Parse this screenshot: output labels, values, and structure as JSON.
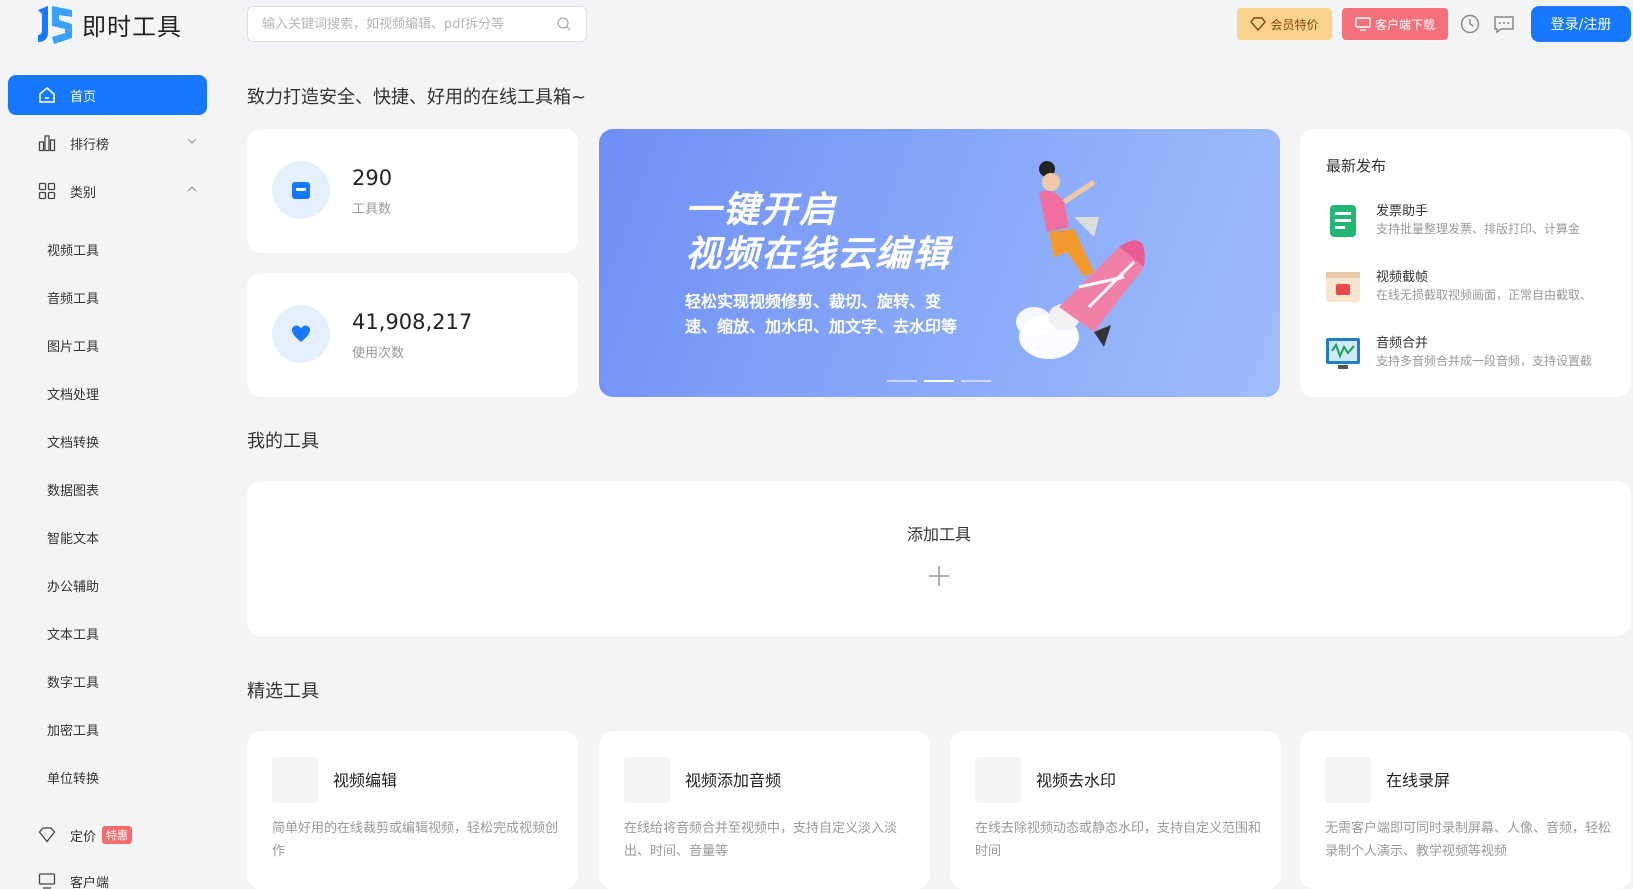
{
  "app": {
    "name": "即时工具"
  },
  "search": {
    "placeholder": "输入关键词搜索，如视频编辑、pdf拆分等"
  },
  "header": {
    "vip_label": "会员特价",
    "download_label": "客户端下载",
    "login_label": "登录/注册"
  },
  "sidebar": {
    "home": "首页",
    "ranking": "排行榜",
    "category": "类别",
    "sub_items": [
      "视频工具",
      "音频工具",
      "图片工具",
      "文档处理",
      "文档转换",
      "数据图表",
      "智能文本",
      "办公辅助",
      "文本工具",
      "数字工具",
      "加密工具",
      "单位转换"
    ],
    "pricing": "定价",
    "pricing_badge": "特惠",
    "client": "客户端"
  },
  "slogan": "致力打造安全、快捷、好用的在线工具箱~",
  "stats": [
    {
      "value": "290",
      "label": "工具数",
      "icon": "box-icon"
    },
    {
      "value": "41,908,217",
      "label": "使用次数",
      "icon": "heart-icon"
    }
  ],
  "banner": {
    "title_line1": "一键开启",
    "title_line2": "视频在线云编辑",
    "subtitle_line1": "轻松实现视频修剪、裁切、旋转、变",
    "subtitle_line2": "速、缩放、加水印、加文字、去水印等",
    "active_slide": 2,
    "slide_count": 3
  },
  "latest": {
    "title": "最新发布",
    "items": [
      {
        "name": "发票助手",
        "desc": "支持批量整理发票、排版打印、计算金",
        "icon": "invoice-icon"
      },
      {
        "name": "视频截帧",
        "desc": "在线无损截取视频画面，正常自由截取、",
        "icon": "video-frame-icon"
      },
      {
        "name": "音频合并",
        "desc": "支持多音频合并成一段音频，支持设置截",
        "icon": "audio-merge-icon"
      }
    ]
  },
  "my_tools": {
    "title": "我的工具",
    "add_label": "添加工具"
  },
  "featured": {
    "title": "精选工具",
    "items": [
      {
        "name": "视频编辑",
        "desc": "简单好用的在线裁剪或编辑视频，轻松完成视频创作"
      },
      {
        "name": "视频添加音频",
        "desc": "在线给将音频合并至视频中，支持自定义淡入淡出、时间、音量等"
      },
      {
        "name": "视频去水印",
        "desc": "在线去除视频动态或静态水印，支持自定义范围和时间"
      },
      {
        "name": "在线录屏",
        "desc": "无需客户端即可同时录制屏幕、人像、音频，轻松录制个人演示、教学视频等视频"
      }
    ]
  },
  "colors": {
    "primary": "#1677ff",
    "vip": "#fbd38a",
    "download": "#f4707a",
    "background": "#f3f4f6"
  }
}
